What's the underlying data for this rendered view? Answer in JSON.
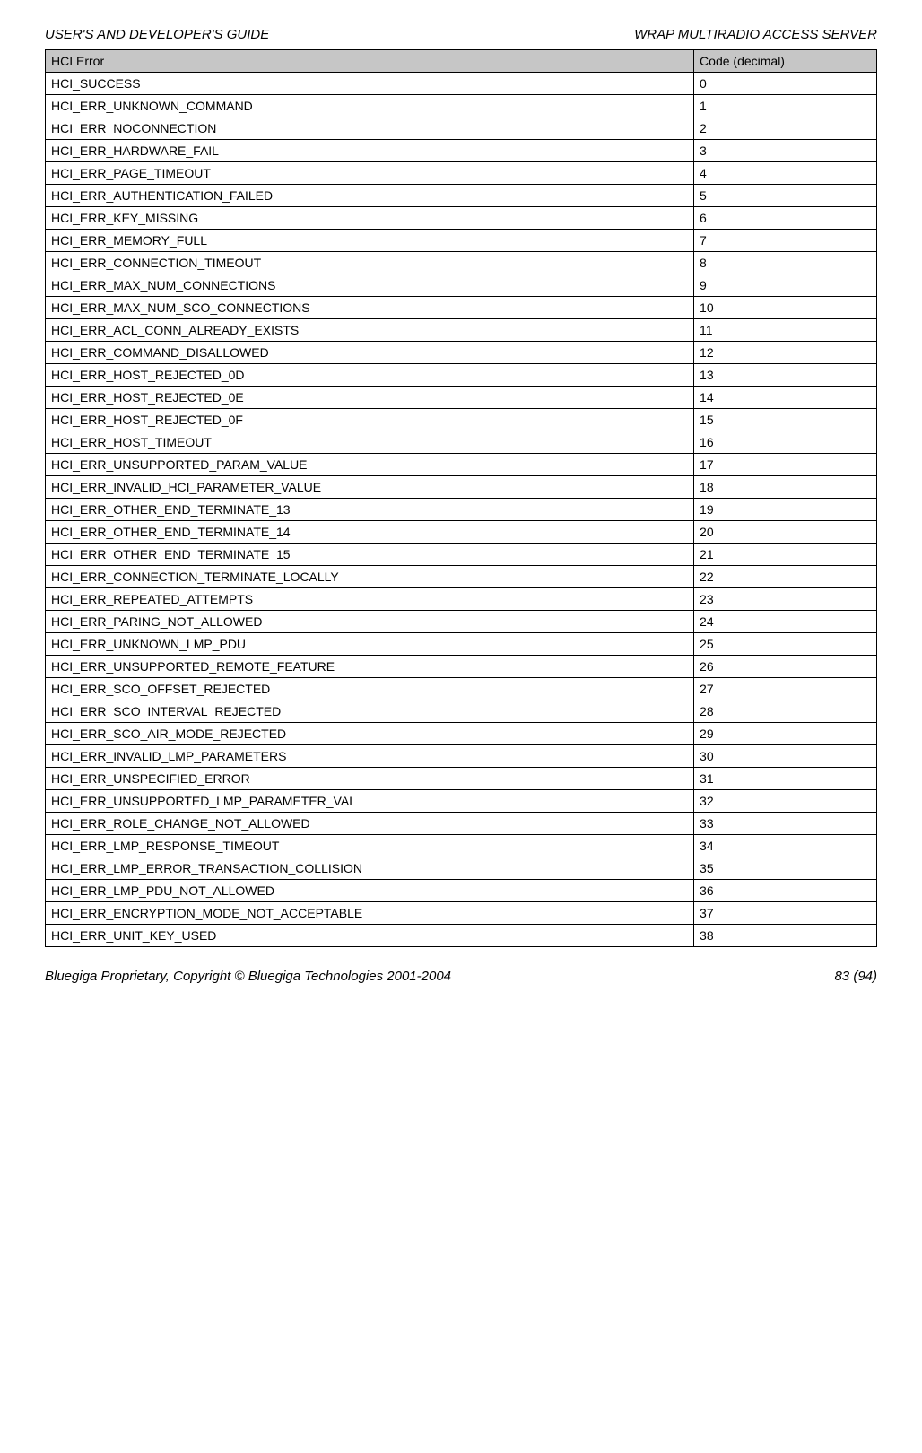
{
  "header": {
    "left": "USER'S AND DEVELOPER'S GUIDE",
    "right": "WRAP MULTIRADIO ACCESS SERVER"
  },
  "table": {
    "head": {
      "error": "HCI Error",
      "code": "Code (decimal)"
    },
    "rows": [
      {
        "error": "HCI_SUCCESS",
        "code": "0"
      },
      {
        "error": "HCI_ERR_UNKNOWN_COMMAND",
        "code": "1"
      },
      {
        "error": "HCI_ERR_NOCONNECTION",
        "code": "2"
      },
      {
        "error": "HCI_ERR_HARDWARE_FAIL",
        "code": "3"
      },
      {
        "error": "HCI_ERR_PAGE_TIMEOUT",
        "code": "4"
      },
      {
        "error": "HCI_ERR_AUTHENTICATION_FAILED",
        "code": "5"
      },
      {
        "error": "HCI_ERR_KEY_MISSING",
        "code": "6"
      },
      {
        "error": "HCI_ERR_MEMORY_FULL",
        "code": "7"
      },
      {
        "error": "HCI_ERR_CONNECTION_TIMEOUT",
        "code": "8"
      },
      {
        "error": "HCI_ERR_MAX_NUM_CONNECTIONS",
        "code": "9"
      },
      {
        "error": "HCI_ERR_MAX_NUM_SCO_CONNECTIONS",
        "code": "10"
      },
      {
        "error": "HCI_ERR_ACL_CONN_ALREADY_EXISTS",
        "code": "11"
      },
      {
        "error": "HCI_ERR_COMMAND_DISALLOWED",
        "code": "12"
      },
      {
        "error": "HCI_ERR_HOST_REJECTED_0D",
        "code": "13"
      },
      {
        "error": "HCI_ERR_HOST_REJECTED_0E",
        "code": "14"
      },
      {
        "error": "HCI_ERR_HOST_REJECTED_0F",
        "code": "15"
      },
      {
        "error": "HCI_ERR_HOST_TIMEOUT",
        "code": "16"
      },
      {
        "error": "HCI_ERR_UNSUPPORTED_PARAM_VALUE",
        "code": "17"
      },
      {
        "error": "HCI_ERR_INVALID_HCI_PARAMETER_VALUE",
        "code": "18"
      },
      {
        "error": "HCI_ERR_OTHER_END_TERMINATE_13",
        "code": "19"
      },
      {
        "error": "HCI_ERR_OTHER_END_TERMINATE_14",
        "code": "20"
      },
      {
        "error": "HCI_ERR_OTHER_END_TERMINATE_15",
        "code": "21"
      },
      {
        "error": "HCI_ERR_CONNECTION_TERMINATE_LOCALLY",
        "code": "22"
      },
      {
        "error": "HCI_ERR_REPEATED_ATTEMPTS",
        "code": "23"
      },
      {
        "error": "HCI_ERR_PARING_NOT_ALLOWED",
        "code": "24"
      },
      {
        "error": "HCI_ERR_UNKNOWN_LMP_PDU",
        "code": "25"
      },
      {
        "error": "HCI_ERR_UNSUPPORTED_REMOTE_FEATURE",
        "code": "26"
      },
      {
        "error": "HCI_ERR_SCO_OFFSET_REJECTED",
        "code": "27"
      },
      {
        "error": "HCI_ERR_SCO_INTERVAL_REJECTED",
        "code": "28"
      },
      {
        "error": "HCI_ERR_SCO_AIR_MODE_REJECTED",
        "code": "29"
      },
      {
        "error": "HCI_ERR_INVALID_LMP_PARAMETERS",
        "code": "30"
      },
      {
        "error": "HCI_ERR_UNSPECIFIED_ERROR",
        "code": "31"
      },
      {
        "error": "HCI_ERR_UNSUPPORTED_LMP_PARAMETER_VAL",
        "code": "32"
      },
      {
        "error": "HCI_ERR_ROLE_CHANGE_NOT_ALLOWED",
        "code": "33"
      },
      {
        "error": "HCI_ERR_LMP_RESPONSE_TIMEOUT",
        "code": "34"
      },
      {
        "error": "HCI_ERR_LMP_ERROR_TRANSACTION_COLLISION",
        "code": "35"
      },
      {
        "error": "HCI_ERR_LMP_PDU_NOT_ALLOWED",
        "code": "36"
      },
      {
        "error": "HCI_ERR_ENCRYPTION_MODE_NOT_ACCEPTABLE",
        "code": "37"
      },
      {
        "error": "HCI_ERR_UNIT_KEY_USED",
        "code": "38"
      }
    ]
  },
  "footer": {
    "left": "Bluegiga Proprietary, Copyright © Bluegiga Technologies 2001-2004",
    "right": "83 (94)"
  }
}
